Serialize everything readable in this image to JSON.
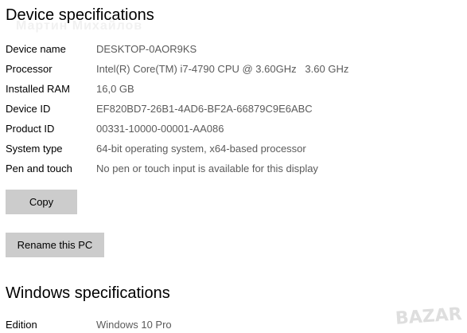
{
  "device_specifications": {
    "heading": "Device specifications",
    "rows": [
      {
        "label": "Device name",
        "value": "DESKTOP-0AOR9KS"
      },
      {
        "label": "Processor",
        "value": "Intel(R) Core(TM) i7-4790 CPU @ 3.60GHz   3.60 GHz"
      },
      {
        "label": "Installed RAM",
        "value": "16,0 GB"
      },
      {
        "label": "Device ID",
        "value": "EF820BD7-26B1-4AD6-BF2A-66879C9E6ABC"
      },
      {
        "label": "Product ID",
        "value": "00331-10000-00001-AA086"
      },
      {
        "label": "System type",
        "value": "64-bit operating system, x64-based processor"
      },
      {
        "label": "Pen and touch",
        "value": "No pen or touch input is available for this display"
      }
    ],
    "copy_button": "Copy",
    "rename_button": "Rename this PC"
  },
  "windows_specifications": {
    "heading": "Windows specifications",
    "rows": [
      {
        "label": "Edition",
        "value": "Windows 10 Pro"
      }
    ]
  },
  "watermarks": {
    "name": "Мартин Михайлов",
    "logo": "BAZAR"
  }
}
